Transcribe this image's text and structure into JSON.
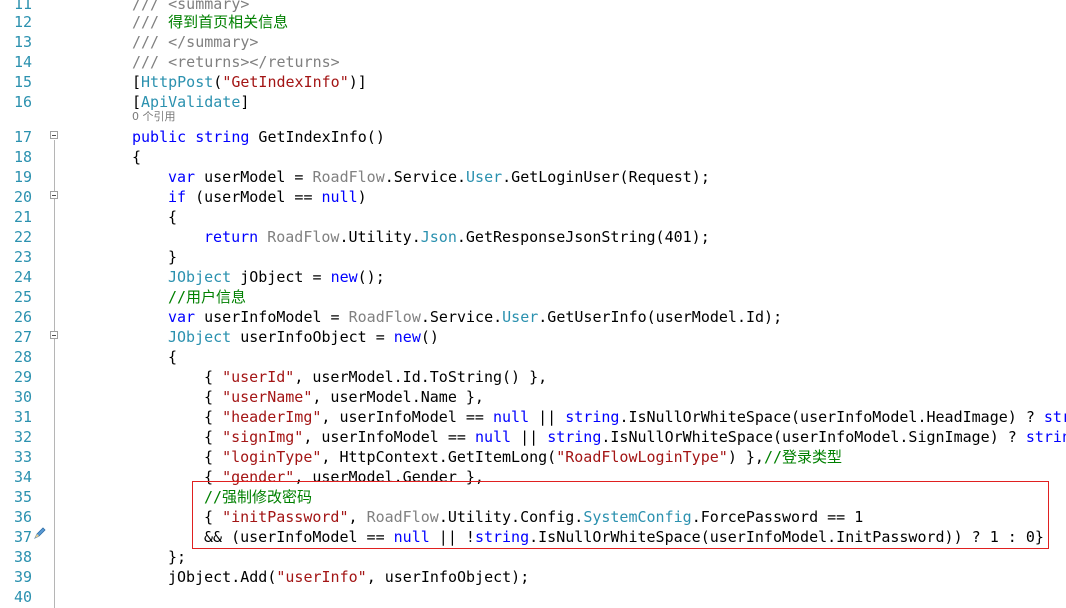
{
  "editor": {
    "line_numbers": [
      "11",
      "12",
      "13",
      "14",
      "15",
      "16",
      "17",
      "18",
      "19",
      "20",
      "21",
      "22",
      "23",
      "24",
      "25",
      "26",
      "27",
      "28",
      "29",
      "30",
      "31",
      "32",
      "33",
      "34",
      "35",
      "36",
      "37",
      "38",
      "39",
      "40"
    ],
    "codelens_text": "0 个引用",
    "lines": [
      {
        "n": "11",
        "segs": [
          {
            "t": "/// ",
            "c": "cmg"
          },
          {
            "t": "<summary>",
            "c": "cmg"
          }
        ]
      },
      {
        "n": "12",
        "segs": [
          {
            "t": "/// ",
            "c": "cmg"
          },
          {
            "t": "得到首页相关信息",
            "c": "cm"
          }
        ]
      },
      {
        "n": "13",
        "segs": [
          {
            "t": "/// ",
            "c": "cmg"
          },
          {
            "t": "</summary>",
            "c": "cmg"
          }
        ]
      },
      {
        "n": "14",
        "segs": [
          {
            "t": "/// ",
            "c": "cmg"
          },
          {
            "t": "<returns></returns>",
            "c": "cmg"
          }
        ]
      },
      {
        "n": "15",
        "segs": [
          {
            "t": "[",
            "c": ""
          },
          {
            "t": "HttpPost",
            "c": "ty"
          },
          {
            "t": "(",
            "c": ""
          },
          {
            "t": "\"GetIndexInfo\"",
            "c": "st"
          },
          {
            "t": ")]",
            "c": ""
          }
        ]
      },
      {
        "n": "16",
        "segs": [
          {
            "t": "[",
            "c": ""
          },
          {
            "t": "ApiValidate",
            "c": "ty"
          },
          {
            "t": "]",
            "c": ""
          }
        ]
      },
      {
        "n": "17",
        "segs": [
          {
            "t": "public",
            "c": "kw"
          },
          {
            "t": " ",
            "c": ""
          },
          {
            "t": "string",
            "c": "kw"
          },
          {
            "t": " GetIndexInfo()",
            "c": ""
          }
        ]
      },
      {
        "n": "18",
        "segs": [
          {
            "t": "{",
            "c": ""
          }
        ]
      },
      {
        "n": "19",
        "segs": [
          {
            "t": "var",
            "c": "kw"
          },
          {
            "t": " userModel = ",
            "c": ""
          },
          {
            "t": "RoadFlow",
            "c": "ns"
          },
          {
            "t": ".Service.",
            "c": ""
          },
          {
            "t": "User",
            "c": "ty"
          },
          {
            "t": ".GetLoginUser(Request);",
            "c": ""
          }
        ]
      },
      {
        "n": "20",
        "segs": [
          {
            "t": "if",
            "c": "kw"
          },
          {
            "t": " (userModel == ",
            "c": ""
          },
          {
            "t": "null",
            "c": "kw"
          },
          {
            "t": ")",
            "c": ""
          }
        ]
      },
      {
        "n": "21",
        "segs": [
          {
            "t": "{",
            "c": ""
          }
        ]
      },
      {
        "n": "22",
        "segs": [
          {
            "t": "return",
            "c": "kw"
          },
          {
            "t": " ",
            "c": ""
          },
          {
            "t": "RoadFlow",
            "c": "ns"
          },
          {
            "t": ".Utility.",
            "c": ""
          },
          {
            "t": "Json",
            "c": "ty"
          },
          {
            "t": ".GetResponseJsonString(401);",
            "c": ""
          }
        ]
      },
      {
        "n": "23",
        "segs": [
          {
            "t": "}",
            "c": ""
          }
        ]
      },
      {
        "n": "24",
        "segs": [
          {
            "t": "JObject",
            "c": "ty"
          },
          {
            "t": " jObject = ",
            "c": ""
          },
          {
            "t": "new",
            "c": "kw"
          },
          {
            "t": "();",
            "c": ""
          }
        ]
      },
      {
        "n": "25",
        "segs": [
          {
            "t": "//用户信息",
            "c": "cm"
          }
        ]
      },
      {
        "n": "26",
        "segs": [
          {
            "t": "var",
            "c": "kw"
          },
          {
            "t": " userInfoModel = ",
            "c": ""
          },
          {
            "t": "RoadFlow",
            "c": "ns"
          },
          {
            "t": ".Service.",
            "c": ""
          },
          {
            "t": "User",
            "c": "ty"
          },
          {
            "t": ".GetUserInfo(userModel.Id);",
            "c": ""
          }
        ]
      },
      {
        "n": "27",
        "segs": [
          {
            "t": "JObject",
            "c": "ty"
          },
          {
            "t": " userInfoObject = ",
            "c": ""
          },
          {
            "t": "new",
            "c": "kw"
          },
          {
            "t": "()",
            "c": ""
          }
        ]
      },
      {
        "n": "28",
        "segs": [
          {
            "t": "{",
            "c": ""
          }
        ]
      },
      {
        "n": "29",
        "segs": [
          {
            "t": "{ ",
            "c": ""
          },
          {
            "t": "\"userId\"",
            "c": "st"
          },
          {
            "t": ", userModel.Id.ToString() },",
            "c": ""
          }
        ]
      },
      {
        "n": "30",
        "segs": [
          {
            "t": "{ ",
            "c": ""
          },
          {
            "t": "\"userName\"",
            "c": "st"
          },
          {
            "t": ", userModel.Name },",
            "c": ""
          }
        ]
      },
      {
        "n": "31",
        "segs": [
          {
            "t": "{ ",
            "c": ""
          },
          {
            "t": "\"headerImg\"",
            "c": "st"
          },
          {
            "t": ", userInfoModel == ",
            "c": ""
          },
          {
            "t": "null",
            "c": "kw"
          },
          {
            "t": " || ",
            "c": ""
          },
          {
            "t": "string",
            "c": "kw"
          },
          {
            "t": ".IsNullOrWhiteSpace(userInfoModel.HeadImage) ? ",
            "c": ""
          },
          {
            "t": "str",
            "c": "kw"
          }
        ]
      },
      {
        "n": "32",
        "segs": [
          {
            "t": "{ ",
            "c": ""
          },
          {
            "t": "\"signImg\"",
            "c": "st"
          },
          {
            "t": ", userInfoModel == ",
            "c": ""
          },
          {
            "t": "null",
            "c": "kw"
          },
          {
            "t": " || ",
            "c": ""
          },
          {
            "t": "string",
            "c": "kw"
          },
          {
            "t": ".IsNullOrWhiteSpace(userInfoModel.SignImage) ? ",
            "c": ""
          },
          {
            "t": "strin",
            "c": "kw"
          }
        ]
      },
      {
        "n": "33",
        "segs": [
          {
            "t": "{ ",
            "c": ""
          },
          {
            "t": "\"loginType\"",
            "c": "st"
          },
          {
            "t": ", HttpContext.GetItemLong(",
            "c": ""
          },
          {
            "t": "\"RoadFlowLoginType\"",
            "c": "st"
          },
          {
            "t": ") },",
            "c": ""
          },
          {
            "t": "//登录类型",
            "c": "cm"
          }
        ]
      },
      {
        "n": "34",
        "segs": [
          {
            "t": "{ ",
            "c": ""
          },
          {
            "t": "\"gender\"",
            "c": "st"
          },
          {
            "t": ", userModel.Gender },",
            "c": ""
          }
        ]
      },
      {
        "n": "35",
        "segs": [
          {
            "t": "//强制修改密码",
            "c": "cm"
          }
        ]
      },
      {
        "n": "36",
        "segs": [
          {
            "t": "{ ",
            "c": ""
          },
          {
            "t": "\"initPassword\"",
            "c": "st"
          },
          {
            "t": ", ",
            "c": ""
          },
          {
            "t": "RoadFlow",
            "c": "ns"
          },
          {
            "t": ".Utility.Config.",
            "c": ""
          },
          {
            "t": "SystemConfig",
            "c": "ty"
          },
          {
            "t": ".ForcePassword == 1",
            "c": ""
          }
        ]
      },
      {
        "n": "37",
        "segs": [
          {
            "t": "&& (userInfoModel == ",
            "c": ""
          },
          {
            "t": "null",
            "c": "kw"
          },
          {
            "t": " || !",
            "c": ""
          },
          {
            "t": "string",
            "c": "kw"
          },
          {
            "t": ".IsNullOrWhiteSpace(userInfoModel.InitPassword)) ? 1 : 0}",
            "c": ""
          }
        ]
      },
      {
        "n": "38",
        "segs": [
          {
            "t": "};",
            "c": ""
          }
        ]
      },
      {
        "n": "39",
        "segs": [
          {
            "t": "jObject.Add(",
            "c": ""
          },
          {
            "t": "\"userInfo\"",
            "c": "st"
          },
          {
            "t": ", userInfoObject);",
            "c": ""
          }
        ]
      },
      {
        "n": "40",
        "segs": [
          {
            "t": "",
            "c": ""
          }
        ]
      }
    ]
  }
}
